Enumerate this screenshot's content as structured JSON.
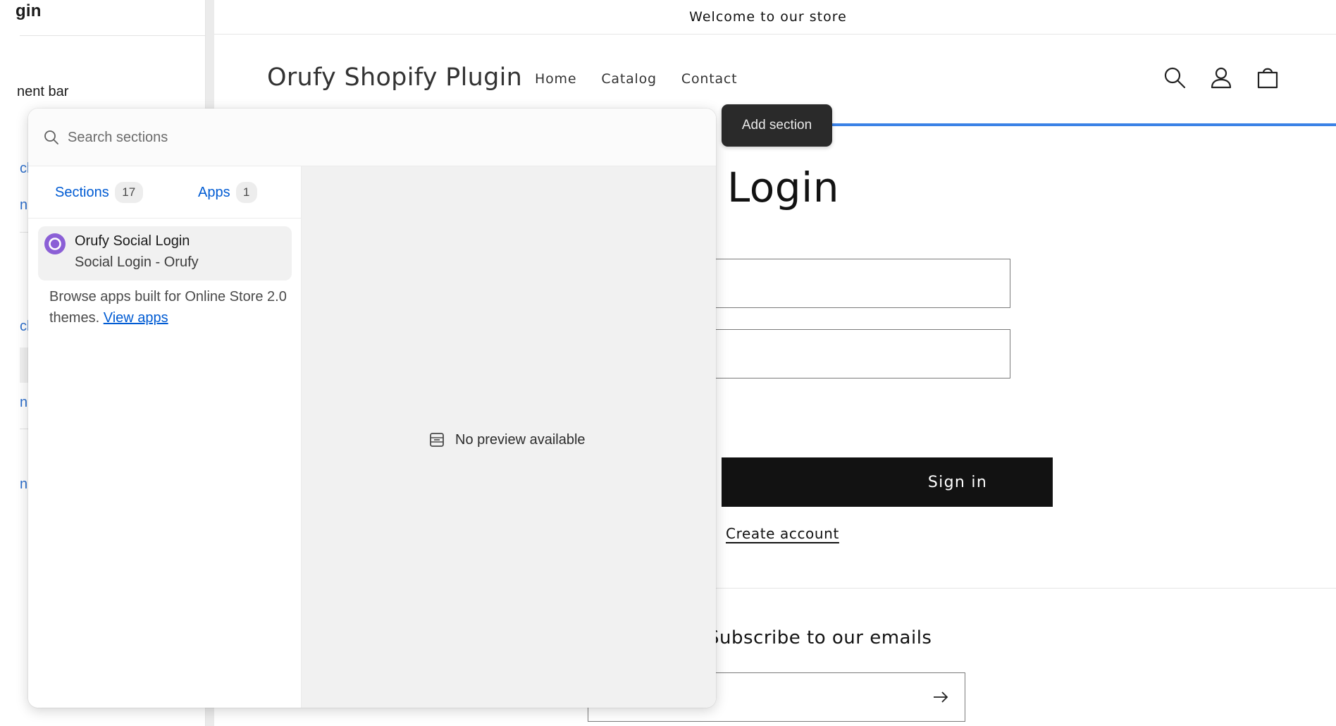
{
  "editor_sidebar": {
    "title_fragment": "gin",
    "announcement_fragment": "nent bar",
    "fragments": [
      {
        "text": "ck",
        "top": 0
      },
      {
        "text": "n",
        "top": 0
      },
      {
        "text": "ck",
        "top": 0
      },
      {
        "text": "n",
        "top": 0
      },
      {
        "text": "n",
        "top": 0
      }
    ]
  },
  "store": {
    "announcement": "Welcome to our store",
    "logo": "Orufy Shopify Plugin",
    "nav": [
      "Home",
      "Catalog",
      "Contact"
    ],
    "login_title": "Login",
    "signin_label": "Sign in",
    "create_account": "Create account",
    "subscribe_title": "Subscribe to our emails"
  },
  "tooltip": {
    "label": "Add section"
  },
  "panel": {
    "search_placeholder": "Search sections",
    "tabs": [
      {
        "label": "Sections",
        "count": "17"
      },
      {
        "label": "Apps",
        "count": "1"
      }
    ],
    "app": {
      "name": "Orufy Social Login",
      "subtitle": "Social Login - Orufy"
    },
    "browse_text": "Browse apps built for Online Store 2.0 themes.",
    "view_apps_label": "View apps",
    "no_preview": "No preview available"
  },
  "colors": {
    "accent_blue": "#005bd3",
    "selection_line": "#3b82e6",
    "app_logo": "#8b5fd6",
    "button_dark": "#121212"
  }
}
